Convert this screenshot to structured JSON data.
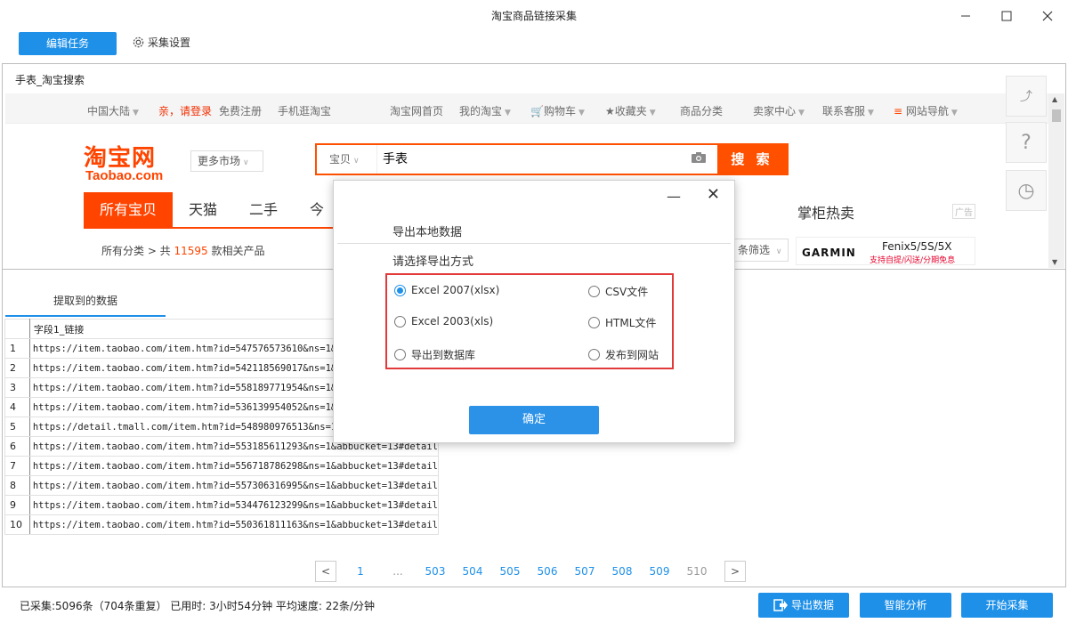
{
  "window": {
    "title": "淘宝商品链接采集",
    "minimize_label": "—",
    "maximize_label": "☐",
    "close_label": "✕"
  },
  "toolbar": {
    "edit_task_label": "编辑任务",
    "settings_label": "采集设置"
  },
  "browser": {
    "tab_title": "手表_淘宝搜索",
    "nav": {
      "region": "中国大陆",
      "login": "亲，请登录",
      "register": "免费注册",
      "mobile": "手机逛淘宝",
      "home": "淘宝网首页",
      "my_taobao": "我的淘宝",
      "cart": "购物车",
      "favorites": "收藏夹",
      "categories": "商品分类",
      "seller_center": "卖家中心",
      "customer_service": "联系客服",
      "site_nav": "网站导航"
    },
    "logo_cn": "淘宝网",
    "logo_en": "Taobao.com",
    "more_market": "更多市场",
    "search": {
      "type": "宝贝",
      "query": "手表",
      "button": "搜 索"
    },
    "category_tabs": [
      "所有宝贝",
      "天猫",
      "二手",
      "今"
    ],
    "crumb": {
      "prefix": "所有分类 >  共 ",
      "count": "11595",
      "suffix": " 款相关产品"
    },
    "filter_label": "条筛选",
    "shopkeeper_hot": "掌柜热卖",
    "ad_label": "广告",
    "ad": {
      "brand": "GARMIN",
      "model": "Fenix5/5S/5X",
      "promo": "支持自提/闪送/分期免息"
    },
    "side_help": "?",
    "side_history": "◷"
  },
  "data_panel": {
    "tab_label": "提取到的数据",
    "column_header": "字段1_链接",
    "rows": [
      {
        "idx": "1",
        "url": "https://item.taobao.com/item.htm?id=547576573610&ns=1&abbucket=13#detail"
      },
      {
        "idx": "2",
        "url": "https://item.taobao.com/item.htm?id=542118569017&ns=1&abbucket=13#detail"
      },
      {
        "idx": "3",
        "url": "https://item.taobao.com/item.htm?id=558189771954&ns=1&abbucket=13#detail"
      },
      {
        "idx": "4",
        "url": "https://item.taobao.com/item.htm?id=536139954052&ns=1&abbucket=13#detail"
      },
      {
        "idx": "5",
        "url": "https://detail.tmall.com/item.htm?id=548980976513&ns=1&abbucket=13"
      },
      {
        "idx": "6",
        "url": "https://item.taobao.com/item.htm?id=553185611293&ns=1&abbucket=13#detail"
      },
      {
        "idx": "7",
        "url": "https://item.taobao.com/item.htm?id=556718786298&ns=1&abbucket=13#detail"
      },
      {
        "idx": "8",
        "url": "https://item.taobao.com/item.htm?id=557306316995&ns=1&abbucket=13#detail"
      },
      {
        "idx": "9",
        "url": "https://item.taobao.com/item.htm?id=534476123299&ns=1&abbucket=13#detail"
      },
      {
        "idx": "10",
        "url": "https://item.taobao.com/item.htm?id=550361811163&ns=1&abbucket=13#detail"
      }
    ]
  },
  "pagination": {
    "prev": "<",
    "pages": [
      "1",
      "...",
      "503",
      "504",
      "505",
      "506",
      "507",
      "508",
      "509",
      "510"
    ],
    "current": "510",
    "next": ">"
  },
  "status": {
    "text": "已采集:5096条（704条重复）  已用时: 3小时54分钟  平均速度: 22条/分钟",
    "export_button": "导出数据",
    "analyze_button": "智能分析",
    "start_button": "开始采集"
  },
  "export_dialog": {
    "heading": "导出本地数据",
    "subheading": "请选择导出方式",
    "options": [
      {
        "label": "Excel 2007(xlsx)",
        "selected": true
      },
      {
        "label": "CSV文件",
        "selected": false
      },
      {
        "label": "Excel 2003(xls)",
        "selected": false
      },
      {
        "label": "HTML文件",
        "selected": false
      },
      {
        "label": "导出到数据库",
        "selected": false
      },
      {
        "label": "发布到网站",
        "selected": false
      }
    ],
    "confirm": "确定",
    "minimize": "—",
    "close": "✕"
  },
  "colors": {
    "accent": "#1e90e8",
    "taobao_orange": "#ff4400",
    "highlight_border": "#e23a3a"
  }
}
